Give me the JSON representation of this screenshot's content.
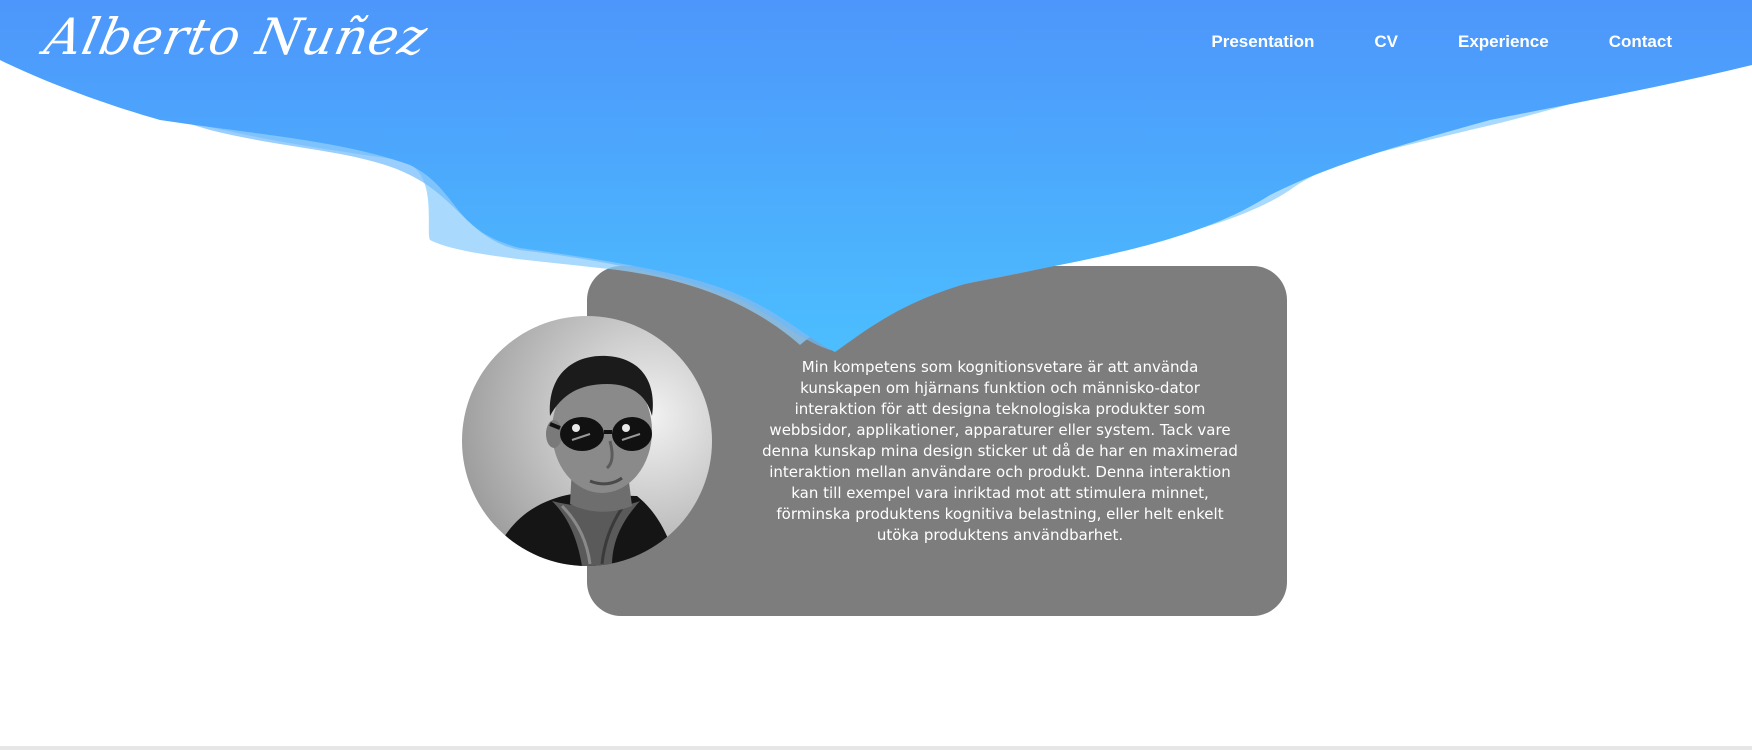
{
  "header": {
    "logo_text": "Alberto Nuñez",
    "nav": [
      {
        "label": "Presentation"
      },
      {
        "label": "CV"
      },
      {
        "label": "Experience"
      },
      {
        "label": "Contact"
      }
    ]
  },
  "main": {
    "intro_text": "Min kompetens som kognitionsvetare är att använda kunskapen om hjärnans funktion och människo-dator interaktion för att designa teknologiska produkter som webbsidor, applikationer, apparaturer eller system. Tack vare denna kunskap mina design sticker ut då de har en maximerad interaktion mellan användare och produkt. Denna interaktion kan till exempel vara inriktad mot att stimulera minnet, förminska produktens kognitiva belastning, eller helt enkelt utöka produktens användbarhet."
  },
  "colors": {
    "wave_top": "#4d96fb",
    "wave_bottom": "#4cbefe",
    "card": "#7d7d7d"
  }
}
